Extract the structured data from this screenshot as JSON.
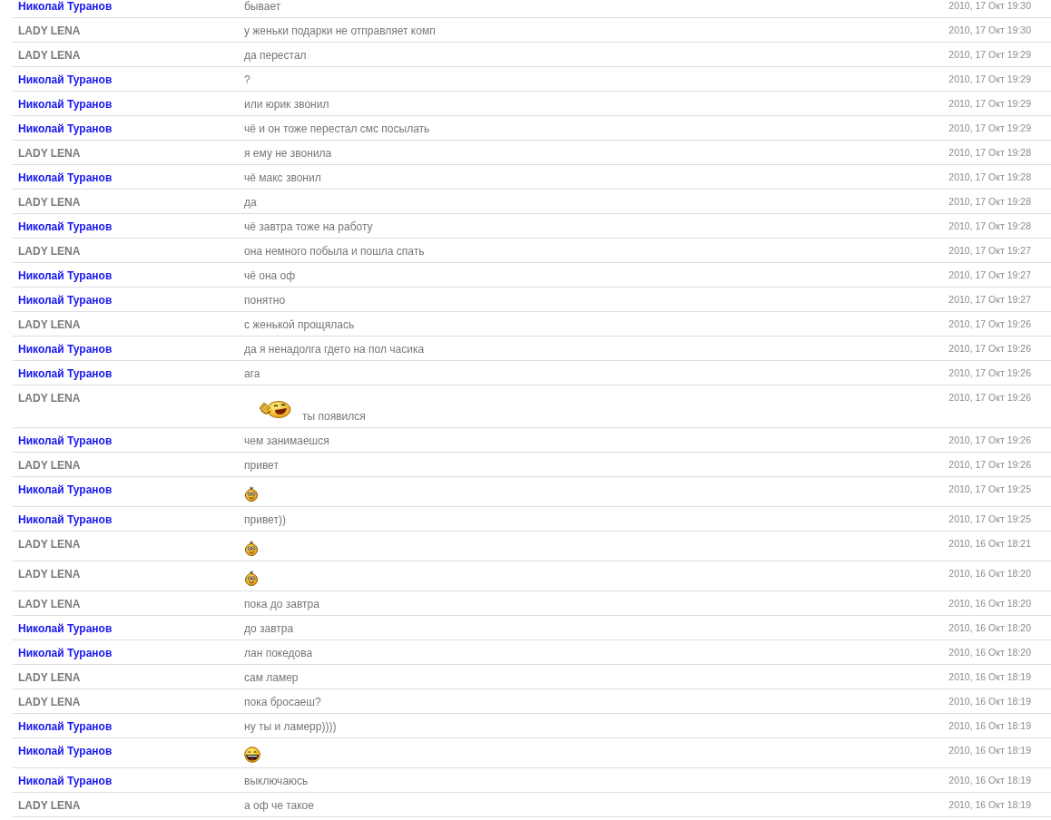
{
  "messages": [
    {
      "author": "Николай Туранов",
      "color": "#1515f0",
      "content": [
        {
          "kind": "text",
          "text": "бывает"
        }
      ],
      "time": "2010, 17 Окт 19:30"
    },
    {
      "author": "LADY LENA",
      "color": "#7a7a7a",
      "content": [
        {
          "kind": "text",
          "text": "у женьки подарки не отправляет комп"
        }
      ],
      "time": "2010, 17 Окт 19:30"
    },
    {
      "author": "LADY LENA",
      "color": "#7a7a7a",
      "content": [
        {
          "kind": "text",
          "text": "да перестал"
        }
      ],
      "time": "2010, 17 Окт 19:29"
    },
    {
      "author": "Николай Туранов",
      "color": "#1515f0",
      "content": [
        {
          "kind": "text",
          "text": "?"
        }
      ],
      "time": "2010, 17 Окт 19:29"
    },
    {
      "author": "Николай Туранов",
      "color": "#1515f0",
      "content": [
        {
          "kind": "text",
          "text": "или юрик звонил"
        }
      ],
      "time": "2010, 17 Окт 19:29"
    },
    {
      "author": "Николай Туранов",
      "color": "#1515f0",
      "content": [
        {
          "kind": "text",
          "text": "чё и он тоже перестал смс посылать"
        }
      ],
      "time": "2010, 17 Окт 19:29"
    },
    {
      "author": "LADY LENA",
      "color": "#7a7a7a",
      "content": [
        {
          "kind": "text",
          "text": "я ему не звонила"
        }
      ],
      "time": "2010, 17 Окт 19:28"
    },
    {
      "author": "Николай Туранов",
      "color": "#1515f0",
      "content": [
        {
          "kind": "text",
          "text": "чё макс звонил"
        }
      ],
      "time": "2010, 17 Окт 19:28"
    },
    {
      "author": "LADY LENA",
      "color": "#7a7a7a",
      "content": [
        {
          "kind": "text",
          "text": "да"
        }
      ],
      "time": "2010, 17 Окт 19:28"
    },
    {
      "author": "Николай Туранов",
      "color": "#1515f0",
      "content": [
        {
          "kind": "text",
          "text": "чё завтра тоже на работу"
        }
      ],
      "time": "2010, 17 Окт 19:28"
    },
    {
      "author": "LADY LENA",
      "color": "#7a7a7a",
      "content": [
        {
          "kind": "text",
          "text": "она немного побыла и пошла спать"
        }
      ],
      "time": "2010, 17 Окт 19:27"
    },
    {
      "author": "Николай Туранов",
      "color": "#1515f0",
      "content": [
        {
          "kind": "text",
          "text": "чё она оф"
        }
      ],
      "time": "2010, 17 Окт 19:27"
    },
    {
      "author": "Николай Туранов",
      "color": "#1515f0",
      "content": [
        {
          "kind": "text",
          "text": "понятно"
        }
      ],
      "time": "2010, 17 Окт 19:27"
    },
    {
      "author": "LADY LENA",
      "color": "#7a7a7a",
      "content": [
        {
          "kind": "text",
          "text": "с женькой прощялась"
        }
      ],
      "time": "2010, 17 Окт 19:26"
    },
    {
      "author": "Николай Туранов",
      "color": "#1515f0",
      "content": [
        {
          "kind": "text",
          "text": "да я ненадолга гдето на пол часика"
        }
      ],
      "time": "2010, 17 Окт 19:26"
    },
    {
      "author": "Николай Туранов",
      "color": "#1515f0",
      "content": [
        {
          "kind": "text",
          "text": "ага"
        }
      ],
      "time": "2010, 17 Окт 19:26"
    },
    {
      "author": "LADY LENA",
      "color": "#7a7a7a",
      "content": [
        {
          "kind": "waving-smiley"
        },
        {
          "kind": "text",
          "text": "ты появился"
        }
      ],
      "time": "2010, 17 Окт 19:26"
    },
    {
      "author": "Николай Туранов",
      "color": "#1515f0",
      "content": [
        {
          "kind": "text",
          "text": "чем занимаешся"
        }
      ],
      "time": "2010, 17 Окт 19:26"
    },
    {
      "author": "LADY LENA",
      "color": "#7a7a7a",
      "content": [
        {
          "kind": "text",
          "text": "привет"
        }
      ],
      "time": "2010, 17 Окт 19:26"
    },
    {
      "author": "Николай Туранов",
      "color": "#1515f0",
      "content": [
        {
          "kind": "smiley"
        }
      ],
      "time": "2010, 17 Окт 19:25"
    },
    {
      "author": "Николай Туранов",
      "color": "#1515f0",
      "content": [
        {
          "kind": "text",
          "text": "привет))"
        }
      ],
      "time": "2010, 17 Окт 19:25"
    },
    {
      "author": "LADY LENA",
      "color": "#7a7a7a",
      "content": [
        {
          "kind": "smiley"
        }
      ],
      "time": "2010, 16 Окт 18:21"
    },
    {
      "author": "LADY LENA",
      "color": "#7a7a7a",
      "content": [
        {
          "kind": "smiley"
        }
      ],
      "time": "2010, 16 Окт 18:20"
    },
    {
      "author": "LADY LENA",
      "color": "#7a7a7a",
      "content": [
        {
          "kind": "text",
          "text": "пока до завтра"
        }
      ],
      "time": "2010, 16 Окт 18:20"
    },
    {
      "author": "Николай Туранов",
      "color": "#1515f0",
      "content": [
        {
          "kind": "text",
          "text": "до завтра"
        }
      ],
      "time": "2010, 16 Окт 18:20"
    },
    {
      "author": "Николай Туранов",
      "color": "#1515f0",
      "content": [
        {
          "kind": "text",
          "text": "лан покедова"
        }
      ],
      "time": "2010, 16 Окт 18:20"
    },
    {
      "author": "LADY LENA",
      "color": "#7a7a7a",
      "content": [
        {
          "kind": "text",
          "text": "сам ламер"
        }
      ],
      "time": "2010, 16 Окт 18:19"
    },
    {
      "author": "LADY LENA",
      "color": "#7a7a7a",
      "content": [
        {
          "kind": "text",
          "text": "пока бросаеш?"
        }
      ],
      "time": "2010, 16 Окт 18:19"
    },
    {
      "author": "Николай Туранов",
      "color": "#1515f0",
      "content": [
        {
          "kind": "text",
          "text": "ну ты и ламерр))))"
        }
      ],
      "time": "2010, 16 Окт 18:19"
    },
    {
      "author": "Николай Туранов",
      "color": "#1515f0",
      "content": [
        {
          "kind": "grinning-smiley"
        }
      ],
      "time": "2010, 16 Окт 18:19"
    },
    {
      "author": "Николай Туранов",
      "color": "#1515f0",
      "content": [
        {
          "kind": "text",
          "text": "выключаюсь"
        }
      ],
      "time": "2010, 16 Окт 18:19"
    },
    {
      "author": "LADY LENA",
      "color": "#7a7a7a",
      "content": [
        {
          "kind": "text",
          "text": "а оф че такое"
        }
      ],
      "time": "2010, 16 Окт 18:19"
    }
  ]
}
